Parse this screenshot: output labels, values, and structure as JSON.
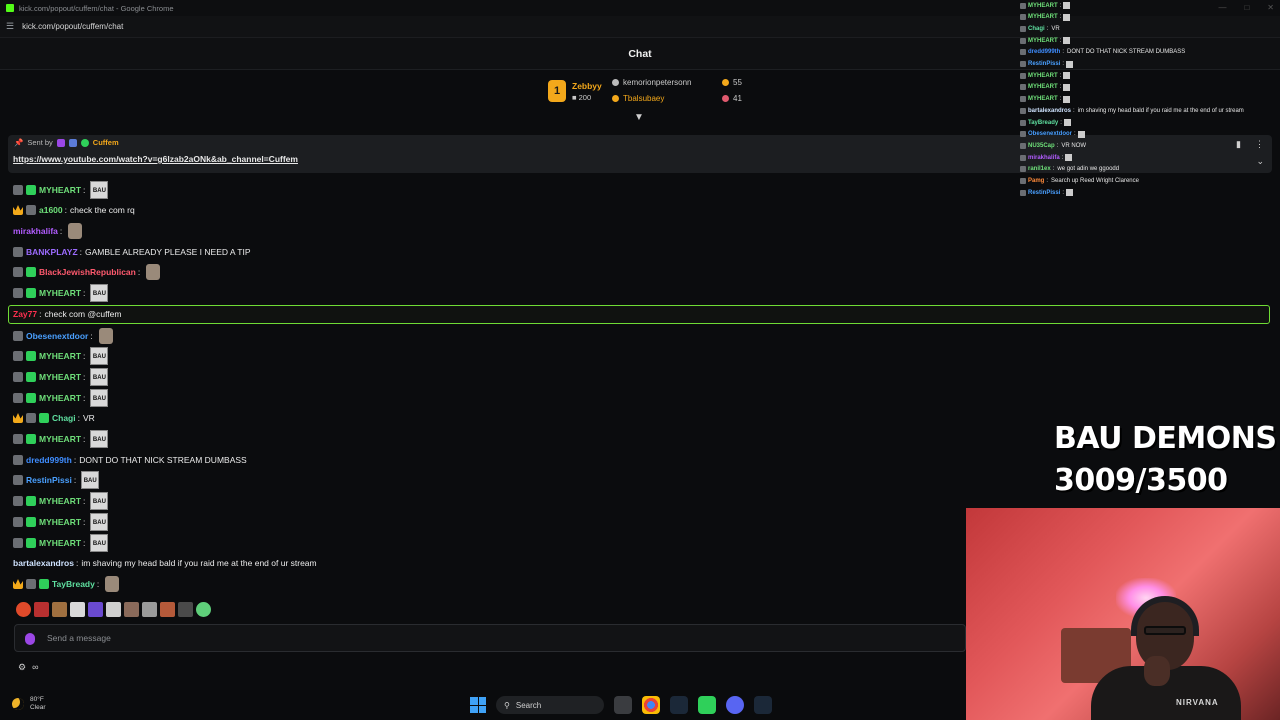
{
  "browser": {
    "window_title": "kick.com/popout/cuffem/chat - Google Chrome",
    "url": "kick.com/popout/cuffem/chat",
    "site_icon": "kick-logo-icon",
    "controls": [
      "minimize-icon",
      "maximize-icon",
      "close-icon"
    ]
  },
  "chat": {
    "title": "Chat",
    "leaderboard": {
      "first": {
        "rank": "1",
        "name": "Zebbyy",
        "value": "200"
      },
      "rows": [
        {
          "name": "kemorionpetersonn",
          "value": "55",
          "color": "#c9c9c9"
        },
        {
          "name": "Tbalsubaey",
          "value": "41",
          "color": "#f3a81b"
        }
      ]
    },
    "pinned": {
      "sent_by_label": "Sent by",
      "sender": "Cuffem",
      "link": "https://www.youtube.com/watch?v=g6lzab2aONk&ab_channel=Cuffem"
    },
    "messages": [
      {
        "badges": [
          "sub",
          "green"
        ],
        "user": "MYHEART",
        "color": "#6fe07a",
        "text": "",
        "emote": "BAU"
      },
      {
        "badges": [
          "crown",
          "sub"
        ],
        "user": "a1600",
        "color": "#6fe07a",
        "text": "check the com rq",
        "emote": ""
      },
      {
        "badges": [],
        "user": "mirakhalifa",
        "color": "#b25cff",
        "text": "",
        "emote": "img"
      },
      {
        "badges": [
          "sub"
        ],
        "user": "BANKPLAYZ",
        "color": "#9c6bff",
        "text": "GAMBLE ALREADY PLEASE I NEED A TIP",
        "emote": ""
      },
      {
        "badges": [
          "sub",
          "green"
        ],
        "user": "BlackJewishRepublican",
        "color": "#ff5a6e",
        "text": "",
        "emote": "img"
      },
      {
        "badges": [
          "sub",
          "green"
        ],
        "user": "MYHEART",
        "color": "#6fe07a",
        "text": "",
        "emote": "BAU"
      },
      {
        "badges": [],
        "user": "Zay77",
        "color": "#ff3050",
        "text": "check com @cuffem",
        "emote": ""
      },
      {
        "badges": [
          "sub"
        ],
        "user": "Obesenextdoor",
        "color": "#4aa0ff",
        "text": "",
        "emote": "img"
      },
      {
        "badges": [
          "sub",
          "green"
        ],
        "user": "MYHEART",
        "color": "#6fe07a",
        "text": "",
        "emote": "BAU"
      },
      {
        "badges": [
          "sub",
          "green"
        ],
        "user": "MYHEART",
        "color": "#6fe07a",
        "text": "",
        "emote": "BAU"
      },
      {
        "badges": [
          "sub",
          "green"
        ],
        "user": "MYHEART",
        "color": "#6fe07a",
        "text": "",
        "emote": "BAU"
      },
      {
        "badges": [
          "crown",
          "sub",
          "green"
        ],
        "user": "Chagi",
        "color": "#5fe0a0",
        "text": "VR",
        "emote": ""
      },
      {
        "badges": [
          "sub",
          "green"
        ],
        "user": "MYHEART",
        "color": "#6fe07a",
        "text": "",
        "emote": "BAU"
      },
      {
        "badges": [
          "sub"
        ],
        "user": "dredd999th",
        "color": "#3f8dff",
        "text": "DONT DO THAT NICK STREAM DUMBASS",
        "emote": ""
      },
      {
        "badges": [
          "sub"
        ],
        "user": "RestinPissi",
        "color": "#4aa0ff",
        "text": "",
        "emote": "BAU"
      },
      {
        "badges": [
          "sub",
          "green"
        ],
        "user": "MYHEART",
        "color": "#6fe07a",
        "text": "",
        "emote": "BAU"
      },
      {
        "badges": [
          "sub",
          "green"
        ],
        "user": "MYHEART",
        "color": "#6fe07a",
        "text": "",
        "emote": "BAU"
      },
      {
        "badges": [
          "sub",
          "green"
        ],
        "user": "MYHEART",
        "color": "#6fe07a",
        "text": "",
        "emote": "BAU"
      },
      {
        "badges": [],
        "user": "bartalexandros",
        "color": "#cfe3ff",
        "text": "im shaving my head bald if you raid me at the end of ur stream",
        "emote": ""
      },
      {
        "badges": [
          "crown",
          "sub",
          "green"
        ],
        "user": "TayBready",
        "color": "#5fe0a0",
        "text": "",
        "emote": "img"
      }
    ],
    "input_placeholder": "Send a message"
  },
  "mini_chat": [
    {
      "user": "MYHEART",
      "text": "",
      "color": "#6fe07a"
    },
    {
      "user": "MYHEART",
      "text": "",
      "color": "#6fe07a"
    },
    {
      "user": "Chagi",
      "text": "VR",
      "color": "#5fe0a0"
    },
    {
      "user": "MYHEART",
      "text": "",
      "color": "#6fe07a"
    },
    {
      "user": "dredd999th",
      "text": "DONT DO THAT NICK STREAM DUMBASS",
      "color": "#3f8dff"
    },
    {
      "user": "RestinPissi",
      "text": "",
      "color": "#4aa0ff"
    },
    {
      "user": "MYHEART",
      "text": "",
      "color": "#6fe07a"
    },
    {
      "user": "MYHEART",
      "text": "",
      "color": "#6fe07a"
    },
    {
      "user": "MYHEART",
      "text": "",
      "color": "#6fe07a"
    },
    {
      "user": "bartalexandros",
      "text": "im shaving my head bald if you raid me at the end of ur stream",
      "color": "#cfe3ff"
    },
    {
      "user": "TayBready",
      "text": "",
      "color": "#5fe0a0"
    },
    {
      "user": "Obesenextdoor",
      "text": "",
      "color": "#4aa0ff"
    },
    {
      "user": "NU35Cap",
      "text": "VR NOW",
      "color": "#6fe07a"
    },
    {
      "user": "mirakhalifa",
      "text": "",
      "color": "#b25cff"
    },
    {
      "user": "ranil1ex",
      "text": "we got adin we ggoodd",
      "color": "#6fe07a"
    },
    {
      "user": "Pamg",
      "text": "Search up Reed Wright Clarence",
      "color": "#ff8a3a"
    },
    {
      "user": "RestinPissi",
      "text": "",
      "color": "#4aa0ff"
    }
  ],
  "goal": {
    "line1": "BAU DEMONS",
    "line2": "3009/3500"
  },
  "webcam": {
    "shirt_text": "NIRVANA"
  },
  "taskbar": {
    "weather_temp": "80°F",
    "weather_cond": "Clear",
    "search_label": "Search"
  }
}
